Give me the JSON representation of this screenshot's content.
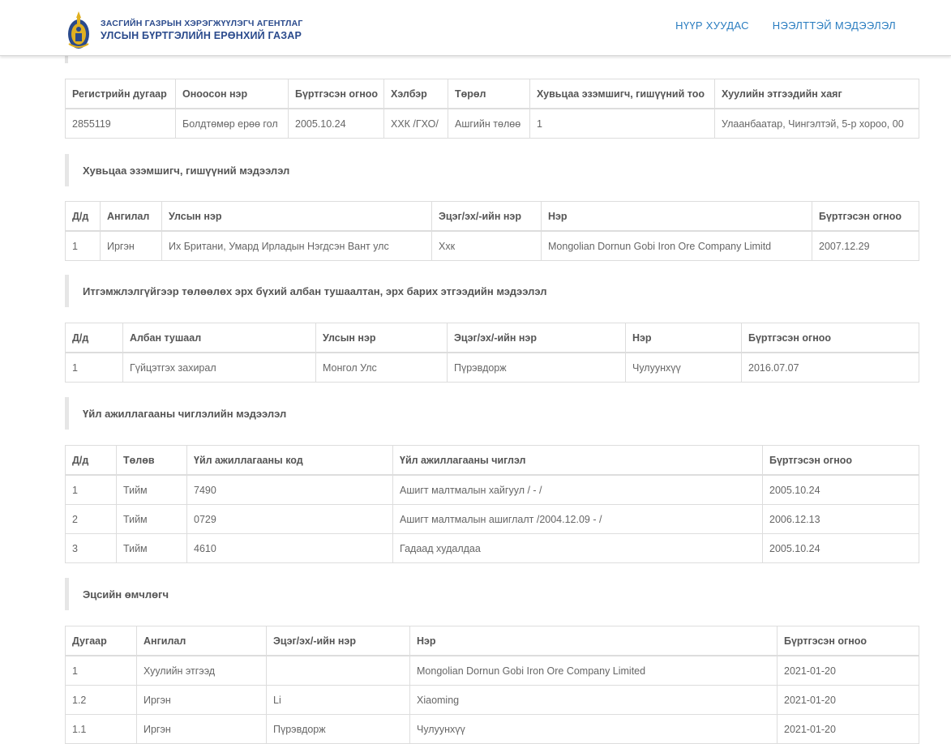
{
  "header": {
    "logo_line1": "ЗАСГИЙН ГАЗРЫН ХЭРЭГЖҮҮЛЭГЧ АГЕНТЛАГ",
    "logo_line2": "УЛСЫН БҮРТГЭЛИЙН ЕРӨНХИЙ ГАЗАР",
    "nav": [
      "НҮҮР ХУУДАС",
      "НЭЭЛТТЭЙ МЭДЭЭЛЭЛ"
    ],
    "colors": {
      "nav": "#2a7dc0",
      "logo": "#2a4a8c",
      "emblem_gold": "#e0b020"
    }
  },
  "company": {
    "headers": [
      "Регистрийн дугаар",
      "Оноосон нэр",
      "Бүртгэсэн огноо",
      "Хэлбэр",
      "Төрөл",
      "Хувьцаа эзэмшигч, гишүүний тоо",
      "Хуулийн этгээдийн хаяг"
    ],
    "row": [
      "2855119",
      "Болдтөмөр ерөө гол",
      "2005.10.24",
      "ХХК /ГХО/",
      "Ашгийн төлөө",
      "1",
      "Улаанбаатар, Чингэлтэй, 5-р хороо, 00"
    ]
  },
  "shareholders": {
    "title": "Хувьцаа эзэмшигч, гишүүний мэдээлэл",
    "headers": [
      "Д/д",
      "Ангилал",
      "Улсын нэр",
      "Эцэг/эх/-ийн нэр",
      "Нэр",
      "Бүртгэсэн огноо"
    ],
    "rows": [
      [
        "1",
        "Иргэн",
        "Их Британи, Умард Ирладын Нэгдсэн Вант улс",
        "Ххк",
        "Mongolian Dornun Gobi Iron Ore Company Limitd",
        "2007.12.29"
      ]
    ]
  },
  "officials": {
    "title": "Итгэмжлэлгүйгээр төлөөлөх эрх бүхий албан тушаалтан, эрх барих этгээдийн мэдээлэл",
    "headers": [
      "Д/д",
      "Албан тушаал",
      "Улсын нэр",
      "Эцэг/эх/-ийн нэр",
      "Нэр",
      "Бүртгэсэн огноо"
    ],
    "rows": [
      [
        "1",
        "Гүйцэтгэх захирал",
        "Монгол Улс",
        "Пүрэвдорж",
        "Чулуунхүү",
        "2016.07.07"
      ]
    ]
  },
  "activities": {
    "title": "Үйл ажиллагааны чиглэлийн мэдээлэл",
    "headers": [
      "Д/д",
      "Төлөв",
      "Үйл ажиллагааны код",
      "Үйл ажиллагааны чиглэл",
      "Бүртгэсэн огноо"
    ],
    "rows": [
      [
        "1",
        "Тийм",
        "7490",
        "Ашигт малтмалын хайгуул / - /",
        "2005.10.24"
      ],
      [
        "2",
        "Тийм",
        "0729",
        "Ашигт малтмалын ашиглалт /2004.12.09 - /",
        "2006.12.13"
      ],
      [
        "3",
        "Тийм",
        "4610",
        "Гадаад худалдаа",
        "2005.10.24"
      ]
    ]
  },
  "owners": {
    "title": "Эцсийн өмчлөгч",
    "headers": [
      "Дугаар",
      "Ангилал",
      "Эцэг/эх/-ийн нэр",
      "Нэр",
      "Бүртгэсэн огноо"
    ],
    "rows": [
      [
        "1",
        "Хуулийн этгээд",
        "",
        "Mongolian Dornun Gobi Iron Ore Company Limited",
        "2021-01-20"
      ],
      [
        "1.2",
        "Иргэн",
        "Li",
        "Xiaoming",
        "2021-01-20"
      ],
      [
        "1.1",
        "Иргэн",
        "Пүрэвдорж",
        "Чулуунхүү",
        "2021-01-20"
      ]
    ]
  }
}
